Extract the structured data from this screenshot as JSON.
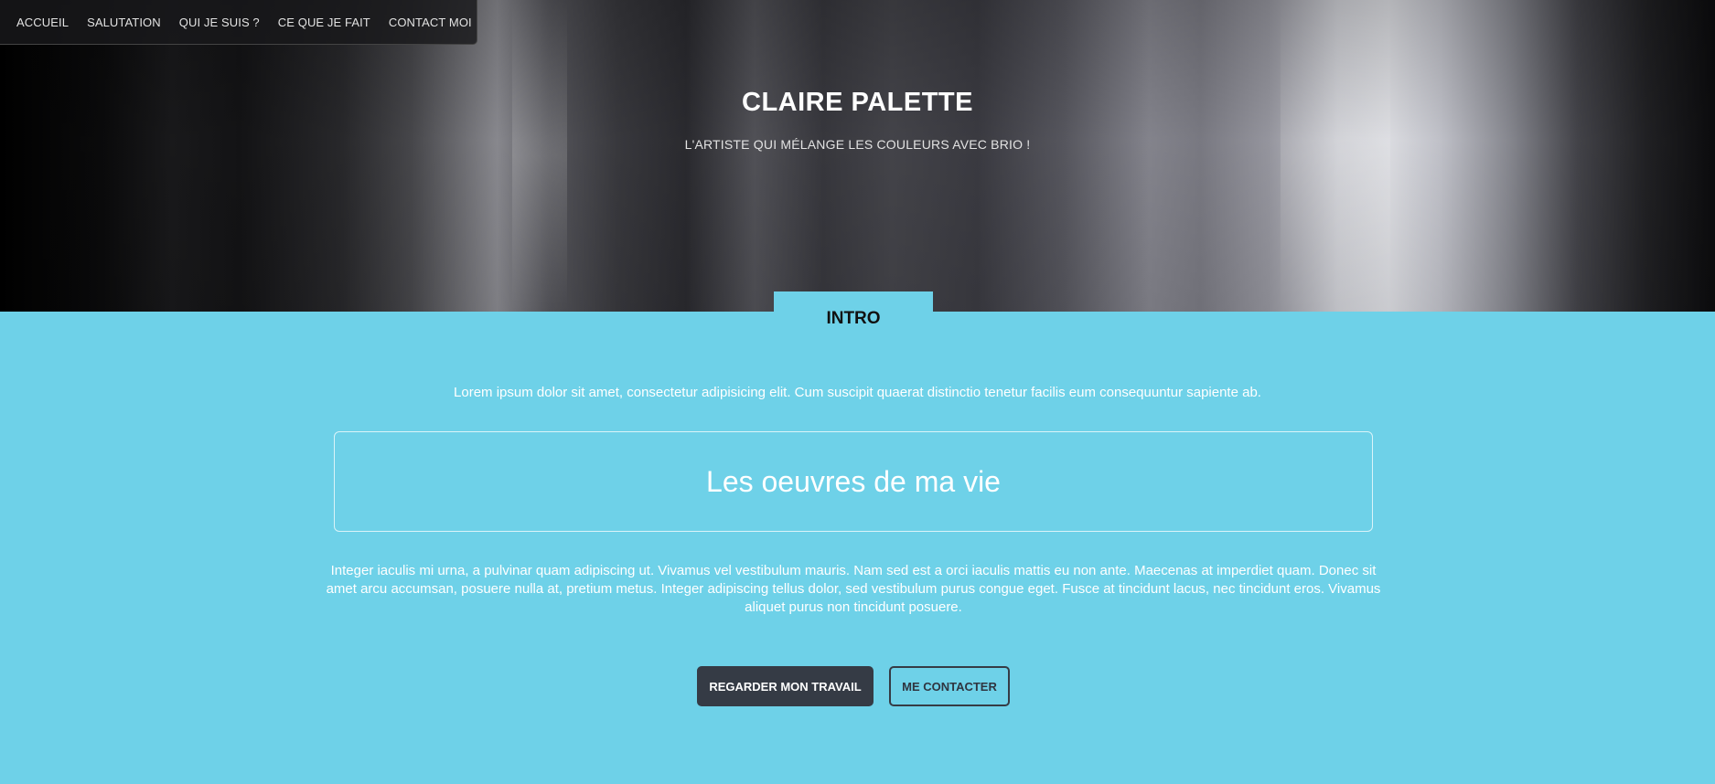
{
  "nav": {
    "items": [
      {
        "label": "ACCUEIL"
      },
      {
        "label": "SALUTATION"
      },
      {
        "label": "QUI JE SUIS ?"
      },
      {
        "label": "CE QUE JE FAIT"
      },
      {
        "label": "CONTACT MOI"
      }
    ]
  },
  "hero": {
    "title": "CLAIRE PALETTE",
    "subtitle": "L'ARTISTE QUI MÉLANGE LES COULEURS AVEC BRIO !"
  },
  "intro": {
    "tab_label": "INTRO",
    "lead": "Lorem ipsum dolor sit amet, consectetur adipisicing elit. Cum suscipit quaerat distinctio tenetur facilis eum consequuntur sapiente ab.",
    "works_heading": "Les oeuvres de ma vie",
    "body": "Integer iaculis mi urna, a pulvinar quam adipiscing ut. Vivamus vel vestibulum mauris. Nam sed est a orci iaculis mattis eu non ante. Maecenas at imperdiet quam. Donec sit amet arcu accumsan, posuere nulla at, pretium metus. Integer adipiscing tellus dolor, sed vestibulum purus congue eget. Fusce at tincidunt lacus, nec tincidunt eros. Vivamus aliquet purus non tincidunt posuere.",
    "primary_button": "REGARDER MON TRAVAIL",
    "secondary_button": "ME CONTACTER"
  },
  "colors": {
    "section_background": "#6ed1e8",
    "button_dark": "#353b45",
    "nav_background": "#19191b"
  }
}
